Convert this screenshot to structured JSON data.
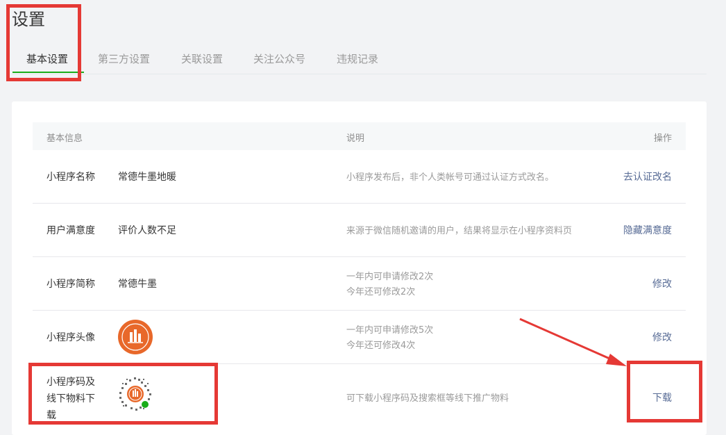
{
  "page": {
    "title": "设置"
  },
  "tabs": [
    {
      "label": "基本设置",
      "active": true
    },
    {
      "label": "第三方设置"
    },
    {
      "label": "关联设置"
    },
    {
      "label": "关注公众号"
    },
    {
      "label": "违规记录"
    }
  ],
  "table": {
    "headers": {
      "info": "基本信息",
      "desc": "说明",
      "action": "操作"
    },
    "rows": [
      {
        "label": "小程序名称",
        "value": "常德牛墨地暖",
        "desc": "小程序发布后，非个人类帐号可通过认证方式改名。",
        "action": "去认证改名"
      },
      {
        "label": "用户满意度",
        "value": "评价人数不足",
        "desc": "来源于微信随机邀请的用户，结果将显示在小程序资料页",
        "action": "隐藏满意度"
      },
      {
        "label": "小程序简称",
        "value": "常德牛墨",
        "desc_line1": "一年内可申请修改2次",
        "desc_line2": "今年还可修改2次",
        "action": "修改"
      },
      {
        "label": "小程序头像",
        "desc_line1": "一年内可申请修改5次",
        "desc_line2": "今年还可修改4次",
        "action": "修改"
      },
      {
        "label_line1": "小程序码及",
        "label_line2": "线下物料下",
        "label_line3": "载",
        "desc": "可下载小程序码及搜索框等线下推广物料",
        "action": "下载"
      }
    ]
  },
  "colors": {
    "accent_green": "#1aad19",
    "link_blue": "#576b95",
    "highlight_red": "#e53935",
    "avatar_orange": "#e8682a"
  }
}
